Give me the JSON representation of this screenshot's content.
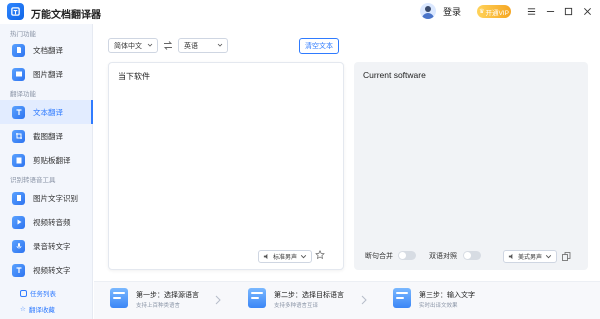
{
  "app": {
    "title": "万能文档翻译器",
    "login_label": "登录",
    "vip_label": "开通VIP"
  },
  "sidebar": {
    "groups": [
      "热门功能",
      "翻译功能",
      "识别转语音工具"
    ],
    "items": [
      {
        "label": "文档翻译",
        "icon": "document-icon"
      },
      {
        "label": "图片翻译",
        "icon": "image-icon"
      },
      {
        "label": "文本翻译",
        "icon": "text-icon",
        "active": true
      },
      {
        "label": "截图翻译",
        "icon": "screenshot-icon"
      },
      {
        "label": "剪贴板翻译",
        "icon": "clipboard-icon"
      },
      {
        "label": "图片文字识别",
        "icon": "ocr-icon"
      },
      {
        "label": "视频转音频",
        "icon": "video-icon"
      },
      {
        "label": "录音转文字",
        "icon": "recording-icon"
      },
      {
        "label": "视频转文字",
        "icon": "video-text-icon"
      }
    ],
    "footer": [
      {
        "label": "任务列表"
      },
      {
        "label": "翻译收藏"
      }
    ]
  },
  "translator": {
    "source_lang": "简体中文",
    "target_lang": "英语",
    "clear_label": "清空文本",
    "source_text": "当下软件",
    "target_text": "Current software",
    "source_voice": "标准男声",
    "target_voice": "美式男声",
    "toggle_sentence": "断句合并",
    "toggle_bilingual": "双语对照",
    "toggle_sentence_on": false,
    "toggle_bilingual_on": false
  },
  "steps": [
    {
      "title": "第一步：选择源语言",
      "sub": "支持上百种类语言"
    },
    {
      "title": "第二步：选择目标语言",
      "sub": "支持多种语言互译"
    },
    {
      "title": "第三步：输入文字",
      "sub": "实时出译文效果"
    }
  ],
  "colors": {
    "accent": "#2f7bff",
    "sidebar_bg": "#f3f6fc",
    "vip": "#f5a623"
  }
}
